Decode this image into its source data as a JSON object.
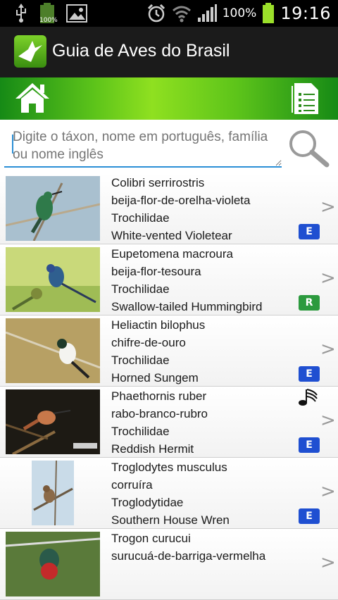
{
  "status_bar": {
    "battery_small_label": "100%",
    "battery_percent": "100%",
    "time": "19:16",
    "icons": [
      "usb-icon",
      "battery-small-icon",
      "picture-icon",
      "alarm-icon",
      "wifi-icon",
      "signal-icon",
      "battery-icon"
    ]
  },
  "app": {
    "title": "Guia de Aves do Brasil",
    "accent": "#5dc41a"
  },
  "toolbar": {
    "icons": [
      "home-icon",
      "document-list-icon"
    ]
  },
  "search": {
    "placeholder": "Digite o táxon, nome em português, família ou nome inglês",
    "value": ""
  },
  "birds": [
    {
      "scientific": "Colibri serrirostris",
      "portuguese": "beija-flor-de-orelha-violeta",
      "family": "Trochilidae",
      "english": "White-vented Violetear",
      "badge": "E",
      "badge_color": "#1f4fd1",
      "sound": false
    },
    {
      "scientific": "Eupetomena macroura",
      "portuguese": "beija-flor-tesoura",
      "family": "Trochilidae",
      "english": "Swallow-tailed Hummingbird",
      "badge": "R",
      "badge_color": "#2c9a3e",
      "sound": false
    },
    {
      "scientific": "Heliactin bilophus",
      "portuguese": "chifre-de-ouro",
      "family": "Trochilidae",
      "english": "Horned Sungem",
      "badge": "E",
      "badge_color": "#1f4fd1",
      "sound": false
    },
    {
      "scientific": "Phaethornis ruber",
      "portuguese": "rabo-branco-rubro",
      "family": "Trochilidae",
      "english": "Reddish Hermit",
      "badge": "E",
      "badge_color": "#1f4fd1",
      "sound": true
    },
    {
      "scientific": "Troglodytes musculus",
      "portuguese": "corruíra",
      "family": "Troglodytidae",
      "english": "Southern House Wren",
      "badge": "E",
      "badge_color": "#1f4fd1",
      "sound": false
    },
    {
      "scientific": "Trogon curucui",
      "portuguese": "surucuá-de-barriga-vermelha",
      "family": "",
      "english": "",
      "badge": "",
      "badge_color": "",
      "sound": false
    }
  ],
  "chevron": ">"
}
